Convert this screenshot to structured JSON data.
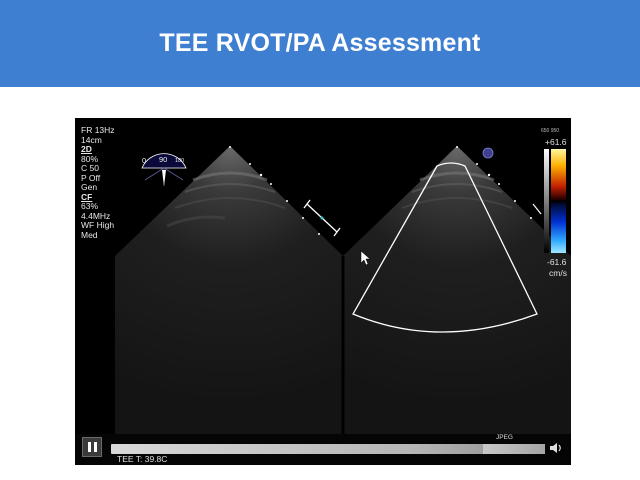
{
  "slide": {
    "title": "TEE RVOT/PA Assessment"
  },
  "viewer": {
    "params": {
      "fr": "FR 13Hz",
      "depth": "14cm",
      "mode_2d": "2D",
      "gain": "80%",
      "compression": "C 50",
      "power": "P Off",
      "gen": "Gen",
      "mode_cf": "CF",
      "cf_gain": "63%",
      "freq": "4.4MHz",
      "wf": "WF High",
      "med": "Med"
    },
    "probe_angle": {
      "zero": "0",
      "value": "90",
      "max": "180"
    },
    "color_scale": {
      "mini": "650 950",
      "top": "+61.6",
      "bottom": "-61.6",
      "unit": "cm/s",
      "colors": {
        "positive": "#ffb000",
        "negative": "#30a8ff"
      }
    },
    "tee_temp": "TEE T: 39.8C",
    "controls": {
      "pause_icon": "pause-icon",
      "format_label": "JPEG",
      "volume_icon": "volume-icon"
    }
  }
}
